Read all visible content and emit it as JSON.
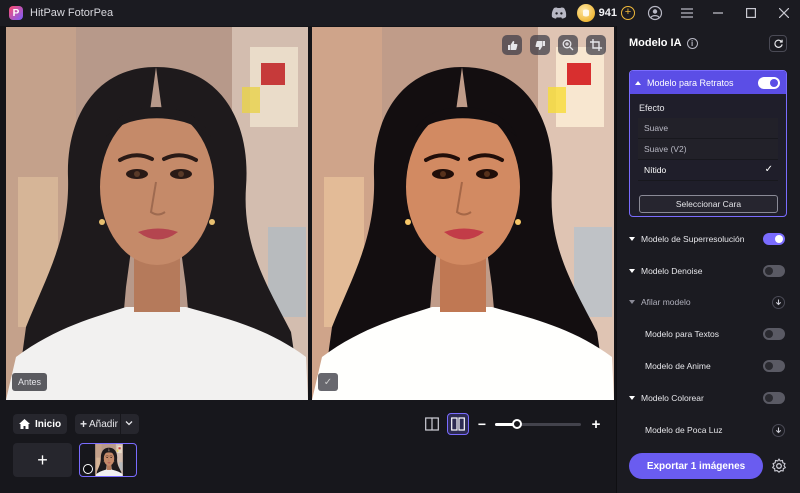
{
  "app": {
    "title": "HitPaw FotorPea",
    "credits": "941"
  },
  "left_pane": {
    "label": "Antes"
  },
  "bottom": {
    "home_label": "Inicio",
    "add_label": "Añadir",
    "zoom_level": 0.25
  },
  "panel": {
    "title": "Modelo IA",
    "portrait": {
      "label": "Modelo para Retratos",
      "enabled": true,
      "effect_label": "Efecto",
      "options": [
        "Suave",
        "Suave (V2)",
        "Nítido"
      ],
      "selected": "Nítido",
      "select_face_label": "Seleccionar Cara"
    },
    "models": [
      {
        "label": "Modelo de Superresolución",
        "control": "toggle",
        "on": true
      },
      {
        "label": "Modelo Denoise",
        "control": "toggle",
        "on": false
      },
      {
        "label": "Afilar modelo",
        "control": "download"
      },
      {
        "label": "Modelo para Textos",
        "control": "toggle",
        "on": false
      },
      {
        "label": "Modelo de Anime",
        "control": "toggle",
        "on": false
      },
      {
        "label": "Modelo Colorear",
        "control": "toggle",
        "on": false
      },
      {
        "label": "Modelo de Poca Luz",
        "control": "download"
      }
    ],
    "export_label": "Exportar 1 imágenes"
  },
  "colors": {
    "accent": "#6a5cf0",
    "panel_bg": "#1b1b21",
    "bg": "#141418"
  }
}
